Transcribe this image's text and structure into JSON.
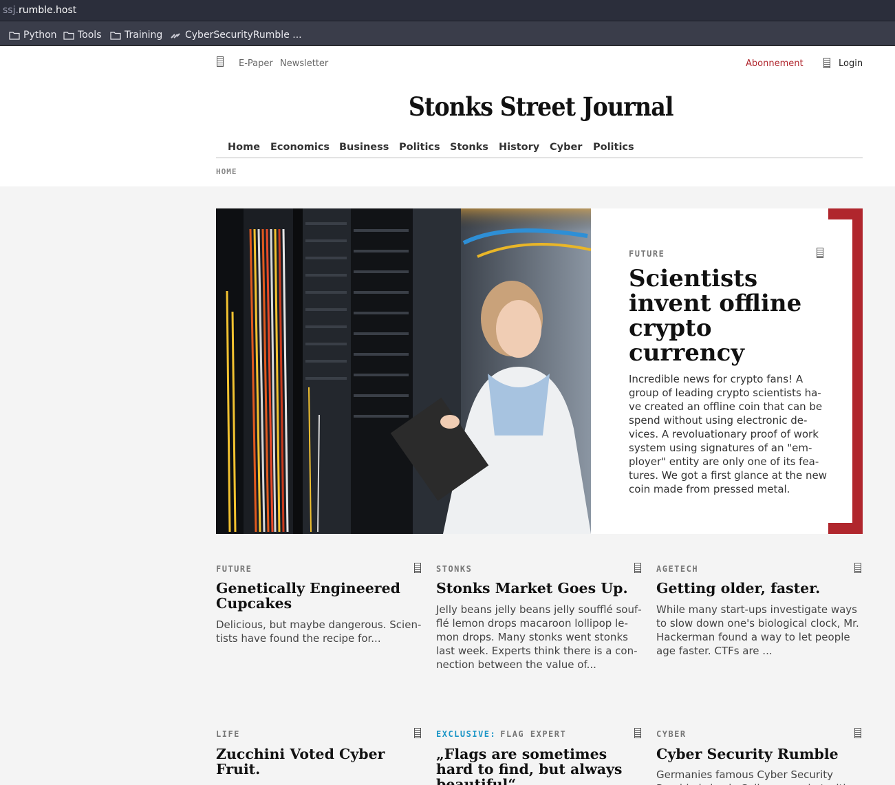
{
  "browser": {
    "url_subdomain": "ssj.",
    "url_domain": "rumble.host",
    "bookmarks": [
      {
        "label": "Python",
        "icon": "folder-icon"
      },
      {
        "label": "Tools",
        "icon": "folder-icon"
      },
      {
        "label": "Training",
        "icon": "folder-icon"
      },
      {
        "label": "CyberSecurityRumble ...",
        "icon": "link-icon"
      }
    ]
  },
  "header": {
    "epaper": "E-Paper",
    "newsletter": "Newsletter",
    "subscription": "Abonnement",
    "login": "Login",
    "masthead": "Stonks Street Journal",
    "nav": [
      "Home",
      "Economics",
      "Business",
      "Politics",
      "Stonks",
      "History",
      "Cyber",
      "Politics"
    ],
    "breadcrumb": "HOME"
  },
  "hero": {
    "kicker": "FUTURE",
    "title": "Scientists invent offline crypto currency",
    "text": "Incredible news for crypto fans! A group of leading crypto scientists ha­ve created an offline coin that can be spend without using electronic de­vices. A revoluationary proof of work system using signatures of an \"em­ployer\" entity are only one of its fea­tures. We got a first glance at the new coin made from pressed metal.",
    "image": "scientist-in-server-room-photo"
  },
  "articles": [
    {
      "kicker": "FUTURE",
      "title": "Genetically Engineered Cupcakes",
      "text": "Delicious, but maybe dangerous. Scien­tists have found the recipe for..."
    },
    {
      "kicker": "STONKS",
      "title": "Stonks Market Goes Up.",
      "text": "Jelly beans jelly beans jelly soufflé souf­flé lemon drops macaroon lollipop le­mon drops. Many stonks went stonks last week. Experts think there is a con­nection between the value of..."
    },
    {
      "kicker": "AGETECH",
      "title": "Getting older, faster.",
      "text": "While many start-ups investigate ways to slow down one's biological clock, Mr. Hackerman found a way to let people age faster. CTFs are ..."
    },
    {
      "kicker": "LIFE",
      "title": "Zucchini Voted Cyber Fruit.",
      "text": ""
    },
    {
      "kicker_prefix": "EXCLUSIVE:",
      "kicker": "FLAG EXPERT",
      "title": "„Flags are sometimes hard to find, but always beautiful“",
      "text": ""
    },
    {
      "kicker": "CYBER",
      "title": "Cyber Security Rumble",
      "text": "Germanies famous Cyber Security Rumble is back. Sell your soul at with"
    }
  ],
  "colors": {
    "accent": "#b0262d",
    "exclusive": "#1a95c6"
  }
}
